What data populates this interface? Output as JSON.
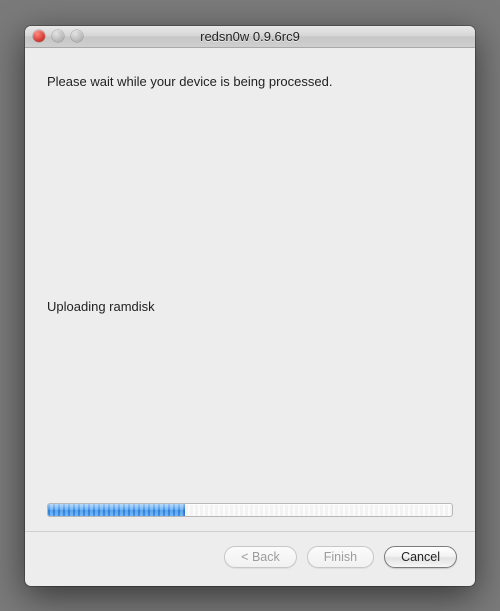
{
  "window": {
    "title": "redsn0w 0.9.6rc9"
  },
  "content": {
    "instruction": "Please wait while your device is being processed.",
    "status": "Uploading ramdisk"
  },
  "progress": {
    "percent": 34
  },
  "buttons": {
    "back": "< Back",
    "finish": "Finish",
    "cancel": "Cancel"
  }
}
